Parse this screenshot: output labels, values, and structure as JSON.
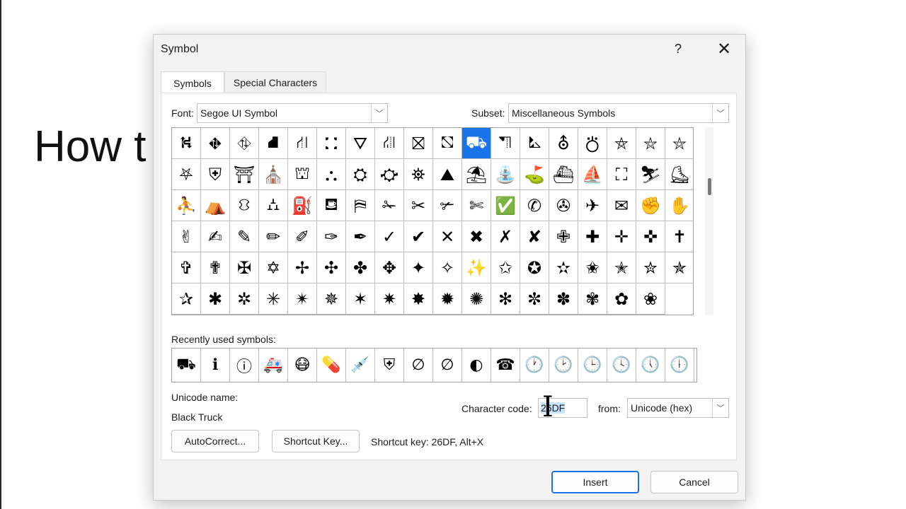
{
  "background": {
    "heading": "How t"
  },
  "dialog": {
    "title": "Symbol",
    "help": "?",
    "close": "✕",
    "tabs": [
      "Symbols",
      "Special Characters"
    ],
    "font_label": "Font:",
    "font_value": "Segoe UI Symbol",
    "subset_label": "Subset:",
    "subset_value": "Miscellaneous Symbols",
    "symbols": [
      "⛕",
      "⛖",
      "⛗",
      "⛘",
      "⛙",
      "⛚",
      "⛛",
      "⛜",
      "⛝",
      "⛞",
      "⛟",
      "⛠",
      "⛡",
      "⛢",
      "⛣",
      "⛤",
      "⛥",
      "⛦",
      "⛧",
      "⛨",
      "⛩",
      "⛪",
      "⛫",
      "⛬",
      "⛭",
      "⛮",
      "⛯",
      "⛰",
      "⛱",
      "⛲",
      "⛳",
      "⛴",
      "⛵",
      "⛶",
      "⛷",
      "⛸",
      "⛹",
      "⛺",
      "⛻",
      "⛼",
      "⛽",
      "⛾",
      "⛿",
      "✁",
      "✂",
      "✃",
      "✄",
      "✅",
      "✆",
      "✇",
      "✈",
      "✉",
      "✊",
      "✋",
      "✌",
      "✍",
      "✎",
      "✏",
      "✐",
      "✑",
      "✒",
      "✓",
      "✔",
      "✕",
      "✖",
      "✗",
      "✘",
      "✙",
      "✚",
      "✛",
      "✜",
      "✝",
      "✞",
      "✟",
      "✠",
      "✡",
      "✢",
      "✣",
      "✤",
      "✥",
      "✦",
      "✧",
      "✨",
      "✩",
      "✪",
      "✫",
      "✬",
      "✭",
      "✮",
      "✯",
      "✰",
      "✱",
      "✲",
      "✳",
      "✴",
      "✵",
      "✶",
      "✷",
      "✸",
      "✹",
      "✺",
      "✻",
      "✼",
      "✽",
      "✾",
      "✿",
      "❀"
    ],
    "selected_index": 10,
    "recent_label": "Recently used symbols:",
    "recent": [
      "⛟",
      "ℹ",
      "ⓘ",
      "🚑",
      "😷",
      "💊",
      "💉",
      "⛨",
      "∅",
      "∅",
      "◐",
      "☎",
      "🕐",
      "🕑",
      "🕒",
      "🕓",
      "🕔",
      "🕕"
    ],
    "unicode_name_label": "Unicode name:",
    "unicode_name_value": "Black Truck",
    "char_code_label": "Character code:",
    "char_code_value": "26DF",
    "from_label": "from:",
    "from_value": "Unicode (hex)",
    "autocorrect_label": "AutoCorrect...",
    "shortcut_key_button": "Shortcut Key...",
    "shortcut_key_text": "Shortcut key: 26DF, Alt+X",
    "insert_label": "Insert",
    "cancel_label": "Cancel"
  }
}
